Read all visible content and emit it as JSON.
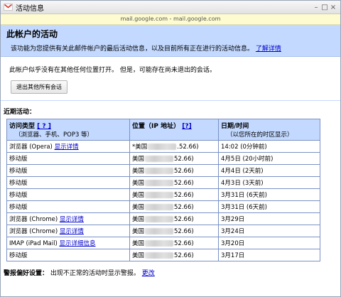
{
  "window": {
    "title": "活动信息",
    "url": "mail.google.com - mail.google.com",
    "min_label": "–",
    "max_label": "□",
    "close_label": "×"
  },
  "header": {
    "title": "此帐户的活动",
    "description": "该功能为您提供有关此邮件帐户的最后活动信息，以及目前所有正在进行的活动信息。",
    "learn_more": "了解详情"
  },
  "status_note": "此帐户似乎没有在其他任何位置打开。 但是，可能存在尚未退出的会话。",
  "logout_button": "退出其他所有会话",
  "recent": {
    "title": "近期活动：",
    "headers": {
      "type": "访问类型",
      "type_help": "[ ? ]",
      "type_sub": "（浏览器、手机、POP3 等）",
      "location": "位置（IP 地址）",
      "location_help": "[?]",
      "datetime": "日期/时间",
      "datetime_sub": "（以您所在的时区显示）"
    },
    "rows": [
      {
        "type": "浏览器 (Opera)",
        "link": "显示详情",
        "loc": "*美国",
        "ip_suffix": ".52.66)",
        "time": "14:02 (0分钟前)"
      },
      {
        "type": "移动版",
        "link": "",
        "loc": "美国",
        "ip_suffix": "52.66)",
        "time": "4月5日 (20小时前)"
      },
      {
        "type": "移动版",
        "link": "",
        "loc": "美国",
        "ip_suffix": "52.66)",
        "time": "4月4日 (2天前)"
      },
      {
        "type": "移动版",
        "link": "",
        "loc": "美国",
        "ip_suffix": "52.66)",
        "time": "4月3日 (3天前)"
      },
      {
        "type": "移动版",
        "link": "",
        "loc": "美国",
        "ip_suffix": "52.66)",
        "time": "3月31日 (6天前)"
      },
      {
        "type": "移动版",
        "link": "",
        "loc": "美国",
        "ip_suffix": "52.66)",
        "time": "3月31日 (6天前)"
      },
      {
        "type": "浏览器 (Chrome)",
        "link": "显示详情",
        "loc": "美国",
        "ip_suffix": "52.66)",
        "time": "3月29日"
      },
      {
        "type": "浏览器 (Chrome)",
        "link": "显示详情",
        "loc": "美国",
        "ip_suffix": "52.66)",
        "time": "3月24日"
      },
      {
        "type": "IMAP (iPad Mail)",
        "link": "显示详细信息",
        "loc": "美国",
        "ip_suffix": "52.66)",
        "time": "3月20日"
      },
      {
        "type": "移动版",
        "link": "",
        "loc": "美国",
        "ip_suffix": "52.66)",
        "time": "3月17日"
      }
    ]
  },
  "alert": {
    "label": "警报偏好设置：",
    "text": "出现不正常的活动时显示警报。",
    "change_link": "更改"
  },
  "colors": {
    "header_bg": "#c3d9ff",
    "link": "#0000cc",
    "url_bar": "#fdfbcf"
  }
}
